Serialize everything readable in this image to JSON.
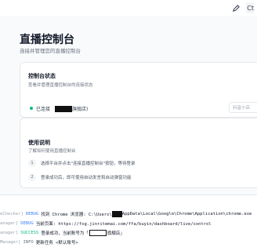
{
  "topbar": {
    "edit_icon": "pencil-icon",
    "avatar_text": "Ct"
  },
  "page": {
    "title": "直播控制台",
    "subtitle": "连接并管理您的直播控制台"
  },
  "status_card": {
    "title": "控制台状态",
    "description": "查看并管理直播控制台的连接状态",
    "status_prefix": "已连接",
    "status_suffix": "旗舰店)",
    "status_color": "#10b981",
    "action_label": "抖音小店"
  },
  "guide_card": {
    "title": "使用说明",
    "description": "了解如何使用直播控制台",
    "steps": [
      {
        "num": "1",
        "text": "选择平台并点击\"连接直播控制台\"按钮，等待登录"
      },
      {
        "num": "2",
        "text": "登录成功后，即可使用自动发言和自动弹窗功能"
      }
    ]
  },
  "console": {
    "lines": [
      {
        "source": "eChecker]",
        "level": "DEBUG",
        "msg_a": "找到 Chrome 浏览器: C:\\Users\\",
        "msg_b": "AppData\\Local\\Google\\Chrome\\Application\\chrome.exe"
      },
      {
        "source": "anager]",
        "level": "DEBUG",
        "msg_a": "当前页面: https://fxg.jinritemai.com/ffa/buyin/dashboard/live/control",
        "msg_b": ""
      },
      {
        "source": "anager]",
        "level": "SUCCESS",
        "msg_a": "登录成功，当前账号为「",
        "msg_b": "旗舰店」"
      },
      {
        "source": "Manager]",
        "level": "INFO",
        "msg_a": "更新任务 <默认账号>",
        "msg_b": ""
      }
    ]
  }
}
